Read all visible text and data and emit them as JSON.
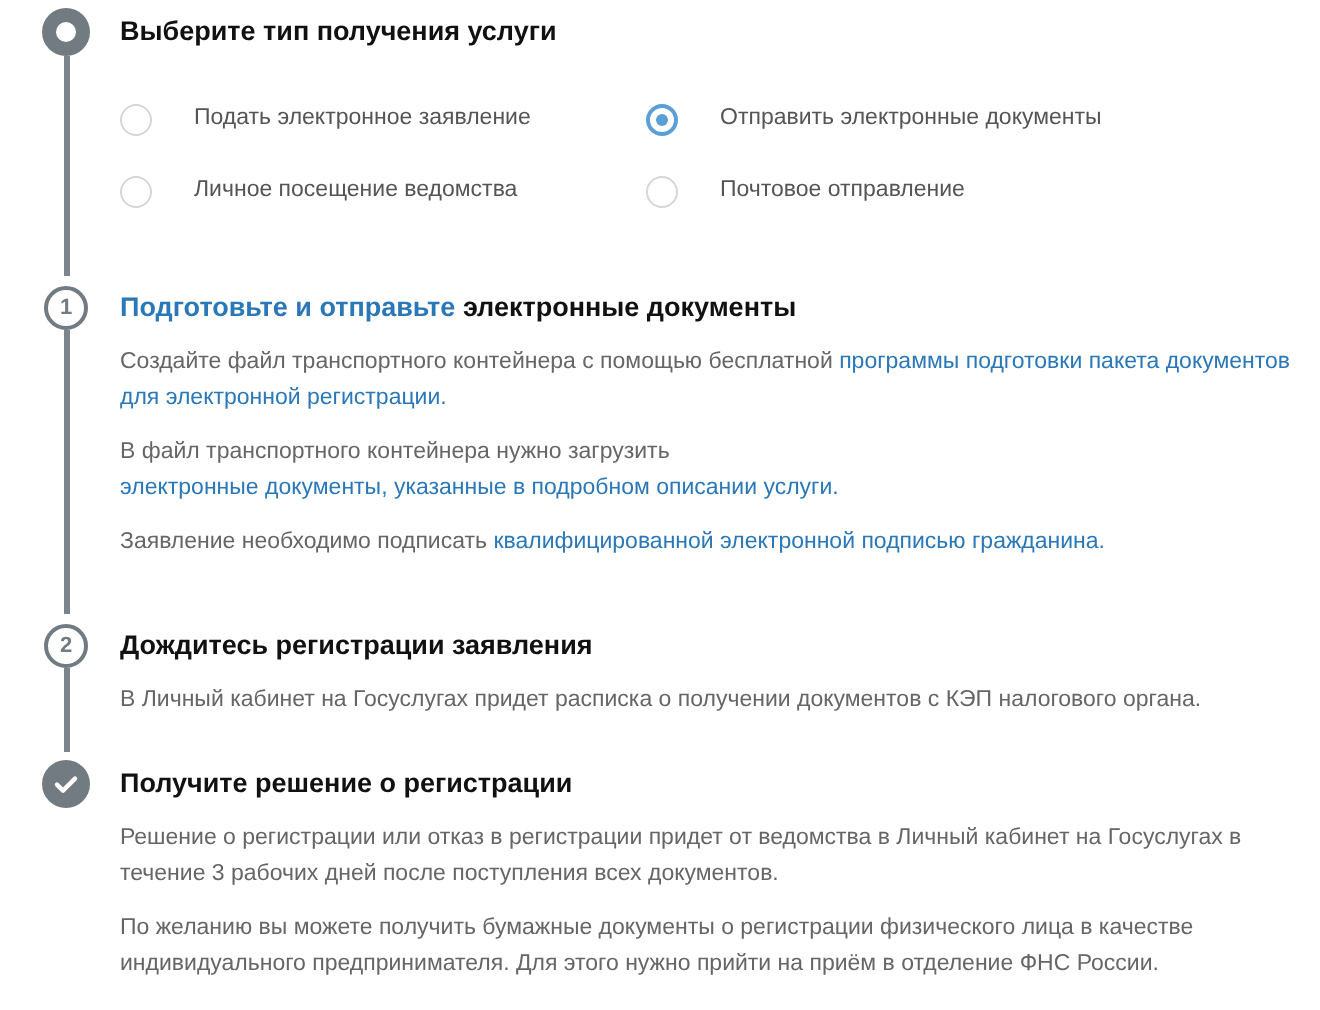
{
  "steps": [
    {
      "kind": "start",
      "title": [
        {
          "text": "Выберите тип получения услуги",
          "link": false
        }
      ],
      "options": [
        {
          "label": "Подать электронное заявление",
          "selected": false
        },
        {
          "label": "Отправить электронные документы",
          "selected": true
        },
        {
          "label": "Личное посещение ведомства",
          "selected": false
        },
        {
          "label": "Почтовое отправление",
          "selected": false
        }
      ]
    },
    {
      "kind": "number",
      "number": "1",
      "title": [
        {
          "text": "Подготовьте и отправьте",
          "link": true
        },
        {
          "text": "электронные документы",
          "link": false
        }
      ],
      "paragraphs": [
        [
          {
            "text": "Создайте файл транспортного контейнера с помощью бесплатной",
            "link": false
          },
          {
            "text": "программы подготовки пакета документов",
            "link": true
          },
          {
            "text": "для электронной регистрации.",
            "link": true
          }
        ],
        [
          {
            "text": "В файл транспортного контейнера нужно загрузить",
            "link": false
          },
          {
            "text": "электронные документы, указанные в подробном описании",
            "link": true
          },
          {
            "text": "услуги.",
            "link": true
          }
        ],
        [
          {
            "text": "Заявление необходимо подписать",
            "link": false
          },
          {
            "text": "квалифицированной электронной подписью гражданина.",
            "link": true
          }
        ]
      ]
    },
    {
      "kind": "number",
      "number": "2",
      "title": [
        {
          "text": "Дождитесь регистрации заявления",
          "link": false
        }
      ],
      "paragraphs": [
        [
          {
            "text": "В Личный кабинет на Госуслугах придет расписка о получении документов с КЭП налогового органа.",
            "link": false
          }
        ]
      ]
    },
    {
      "kind": "check",
      "title": [
        {
          "text": "Получите решение о регистрации",
          "link": false
        }
      ],
      "paragraphs": [
        [
          {
            "text": "Решение о регистрации или отказ в регистрации придет от ведомства в Личный кабинет на Госуслугах в течение 3 рабочих дней после поступления всех документов.",
            "link": false
          }
        ],
        [
          {
            "text": "По желанию вы можете получить бумажные документы о регистрации физического лица в качестве индивидуального предпринимателя. Для этого нужно прийти на приём в отделение ФНС России.",
            "link": false
          }
        ]
      ]
    }
  ]
}
